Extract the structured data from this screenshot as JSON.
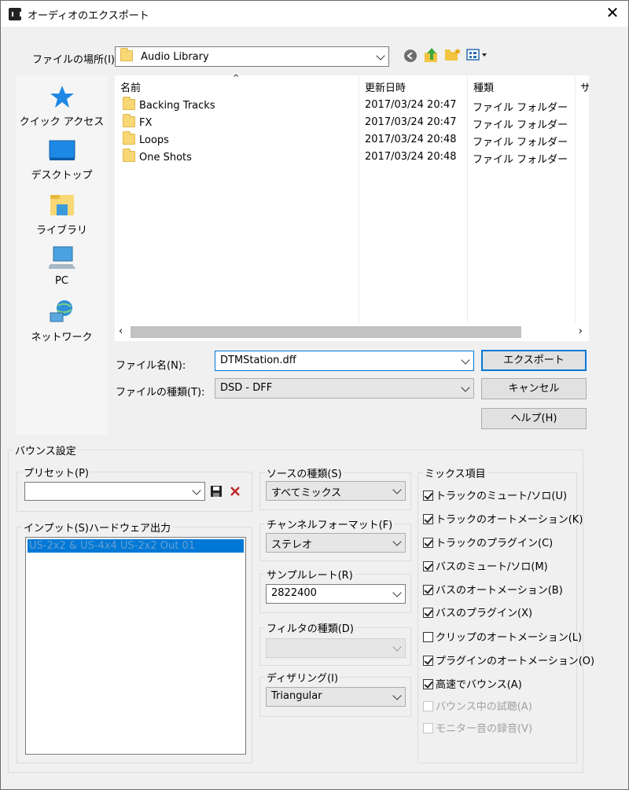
{
  "window": {
    "title": "オーディオのエクスポート",
    "close": "✕"
  },
  "location": {
    "label": "ファイルの場所(I):",
    "value": "Audio Library"
  },
  "sidebar": {
    "items": [
      "クイック アクセス",
      "デスクトップ",
      "ライブラリ",
      "PC",
      "ネットワーク"
    ]
  },
  "filelist": {
    "columns": [
      "名前",
      "更新日時",
      "種類",
      "サ"
    ],
    "rows": [
      {
        "name": "Backing Tracks",
        "date": "2017/03/24 20:47",
        "type": "ファイル フォルダー"
      },
      {
        "name": "FX",
        "date": "2017/03/24 20:47",
        "type": "ファイル フォルダー"
      },
      {
        "name": "Loops",
        "date": "2017/03/24 20:48",
        "type": "ファイル フォルダー"
      },
      {
        "name": "One Shots",
        "date": "2017/03/24 20:48",
        "type": "ファイル フォルダー"
      }
    ]
  },
  "filename": {
    "label": "ファイル名(N):",
    "value": "DTMStation.dff"
  },
  "filetype": {
    "label": "ファイルの種類(T):",
    "value": "DSD - DFF"
  },
  "buttons": {
    "export": "エクスポート",
    "cancel": "キャンセル",
    "help": "ヘルプ(H)"
  },
  "bounce": {
    "title": "バウンス設定",
    "preset": {
      "label": "プリセット(P)",
      "value": ""
    },
    "input": {
      "label": "インプット(S)ハードウェア出力",
      "items": [
        "US-2x2 & US-4x4 US-2x2 Out 01"
      ]
    },
    "source": {
      "label": "ソースの種類(S)",
      "value": "すべてミックス"
    },
    "channel": {
      "label": "チャンネルフォーマット(F)",
      "value": "ステレオ"
    },
    "samplerate": {
      "label": "サンプルレート(R)",
      "value": "2822400"
    },
    "filter": {
      "label": "フィルタの種類(D)",
      "value": ""
    },
    "dither": {
      "label": "ディザリング(I)",
      "value": "Triangular"
    },
    "mix": {
      "label": "ミックス項目",
      "items": [
        {
          "label": "トラックのミュート/ソロ(U)",
          "checked": true,
          "enabled": true
        },
        {
          "label": "トラックのオートメーション(K)",
          "checked": true,
          "enabled": true
        },
        {
          "label": "トラックのプラグイン(C)",
          "checked": true,
          "enabled": true
        },
        {
          "label": "バスのミュート/ソロ(M)",
          "checked": true,
          "enabled": true
        },
        {
          "label": "バスのオートメーション(B)",
          "checked": true,
          "enabled": true
        },
        {
          "label": "バスのプラグイン(X)",
          "checked": true,
          "enabled": true
        },
        {
          "label": "クリップのオートメーション(L)",
          "checked": false,
          "enabled": true
        },
        {
          "label": "プラグインのオートメーション(O)",
          "checked": true,
          "enabled": true
        },
        {
          "label": "高速でバウンス(A)",
          "checked": true,
          "enabled": true
        },
        {
          "label": "バウンス中の試聴(A)",
          "checked": false,
          "enabled": false
        },
        {
          "label": "モニター音の録音(V)",
          "checked": false,
          "enabled": false
        }
      ]
    }
  },
  "colors": {
    "accent": "#0078d7",
    "folder": "#f8d775"
  }
}
